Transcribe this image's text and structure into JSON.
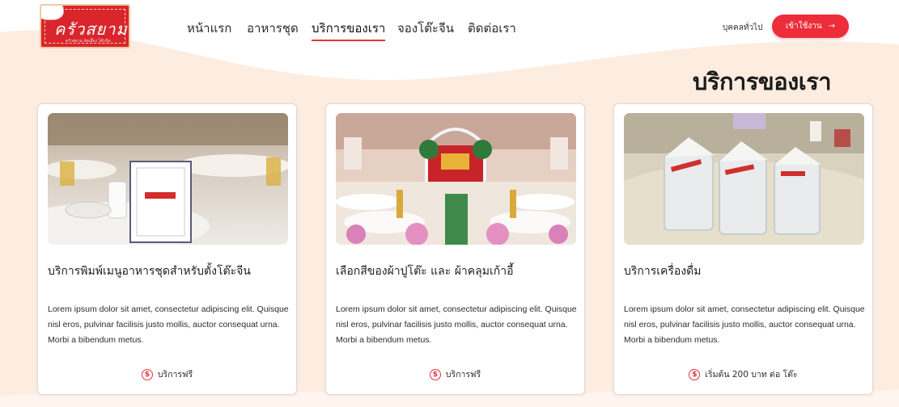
{
  "brand": {
    "logo_text": "ครัวสยาม",
    "logo_sub": "ครัวสยาม จัดเลี้ยง โต๊ะจีน"
  },
  "nav": {
    "items": [
      {
        "label": "หน้าแรก"
      },
      {
        "label": "อาหารชุด"
      },
      {
        "label": "บริการของเรา"
      },
      {
        "label": "จองโต๊ะจีน"
      },
      {
        "label": "ติดต่อเรา"
      }
    ],
    "active_index": 2,
    "general_label": "บุคคลทั่วไป",
    "login_label": "เข้าใช้งาน",
    "login_arrow": "→"
  },
  "page": {
    "title": "บริการของเรา"
  },
  "cards": [
    {
      "title": "บริการพิมพ์เมนูอาหารชุดสำหรับตั้งโต๊ะจีน",
      "description": "Lorem ipsum dolor sit amet, consectetur adipiscing elit. Quisque nisl eros, pulvinar facilisis justo mollis, auctor consequat urna. Morbi a bibendum metus.",
      "price_icon": "$",
      "price": "บริการฟรี"
    },
    {
      "title": "เลือกสีของผ้าปูโต๊ะ และ ผ้าคลุมเก้าอี้",
      "description": "Lorem ipsum dolor sit amet, consectetur adipiscing elit. Quisque nisl eros, pulvinar facilisis justo mollis, auctor consequat urna. Morbi a bibendum metus.",
      "price_icon": "$",
      "price": "บริการฟรี"
    },
    {
      "title": "บริการเครื่องดื่ม",
      "description": "Lorem ipsum dolor sit amet, consectetur adipiscing elit. Quisque nisl eros, pulvinar facilisis justo mollis, auctor consequat urna. Morbi a bibendum metus.",
      "price_icon": "$",
      "price": "เริ่มต้น 200 บาท ต่อ โต๊ะ"
    }
  ],
  "colors": {
    "accent": "#ee2d3b",
    "background_wave": "#fdecdf"
  }
}
